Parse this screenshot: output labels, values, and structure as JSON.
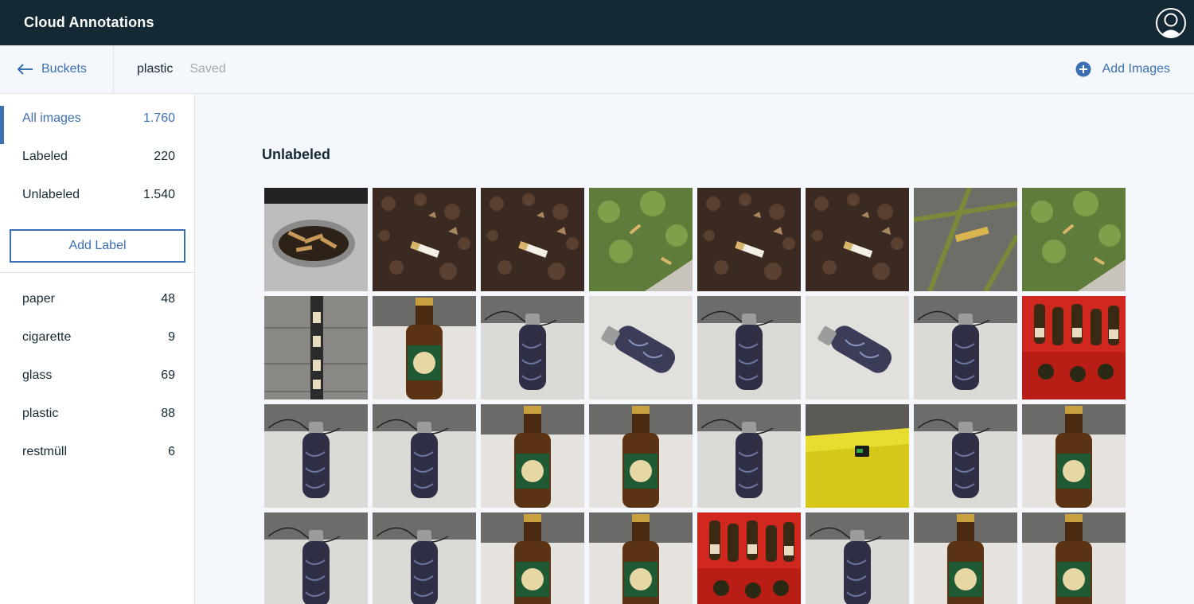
{
  "app": {
    "title": "Cloud Annotations"
  },
  "subheader": {
    "back_label": "Buckets",
    "bucket_name": "plastic",
    "save_state": "Saved",
    "add_images_label": "Add Images"
  },
  "filters": [
    {
      "label": "All images",
      "count": "1.760"
    },
    {
      "label": "Labeled",
      "count": "220"
    },
    {
      "label": "Unlabeled",
      "count": "1.540"
    }
  ],
  "add_label_button": "Add Label",
  "labels": [
    {
      "label": "paper",
      "count": "48"
    },
    {
      "label": "cigarette",
      "count": "9"
    },
    {
      "label": "glass",
      "count": "69"
    },
    {
      "label": "plastic",
      "count": "88"
    },
    {
      "label": "restmüll",
      "count": "6"
    }
  ],
  "main": {
    "section_title": "Unlabeled",
    "images": [
      "ashtray-cigarettes",
      "cigarette-on-leaves",
      "cigarette-on-leaves",
      "cigarettes-on-grass",
      "cigarette-on-leaves",
      "cigarette-on-leaves",
      "cigarette-on-pavement",
      "cigarettes-on-grass",
      "cigarettes-in-drain",
      "beer-bottle",
      "steel-bottle",
      "steel-bottle-lying",
      "steel-bottle",
      "steel-bottle-lying",
      "steel-bottle",
      "beer-crate",
      "steel-bottle",
      "steel-bottle",
      "beer-bottle",
      "beer-bottle",
      "steel-bottle",
      "yellow-surface",
      "steel-bottle",
      "beer-bottle",
      "steel-bottle",
      "steel-bottle",
      "beer-bottle",
      "beer-bottle",
      "beer-crate",
      "steel-bottle",
      "beer-bottle",
      "beer-bottle"
    ]
  }
}
